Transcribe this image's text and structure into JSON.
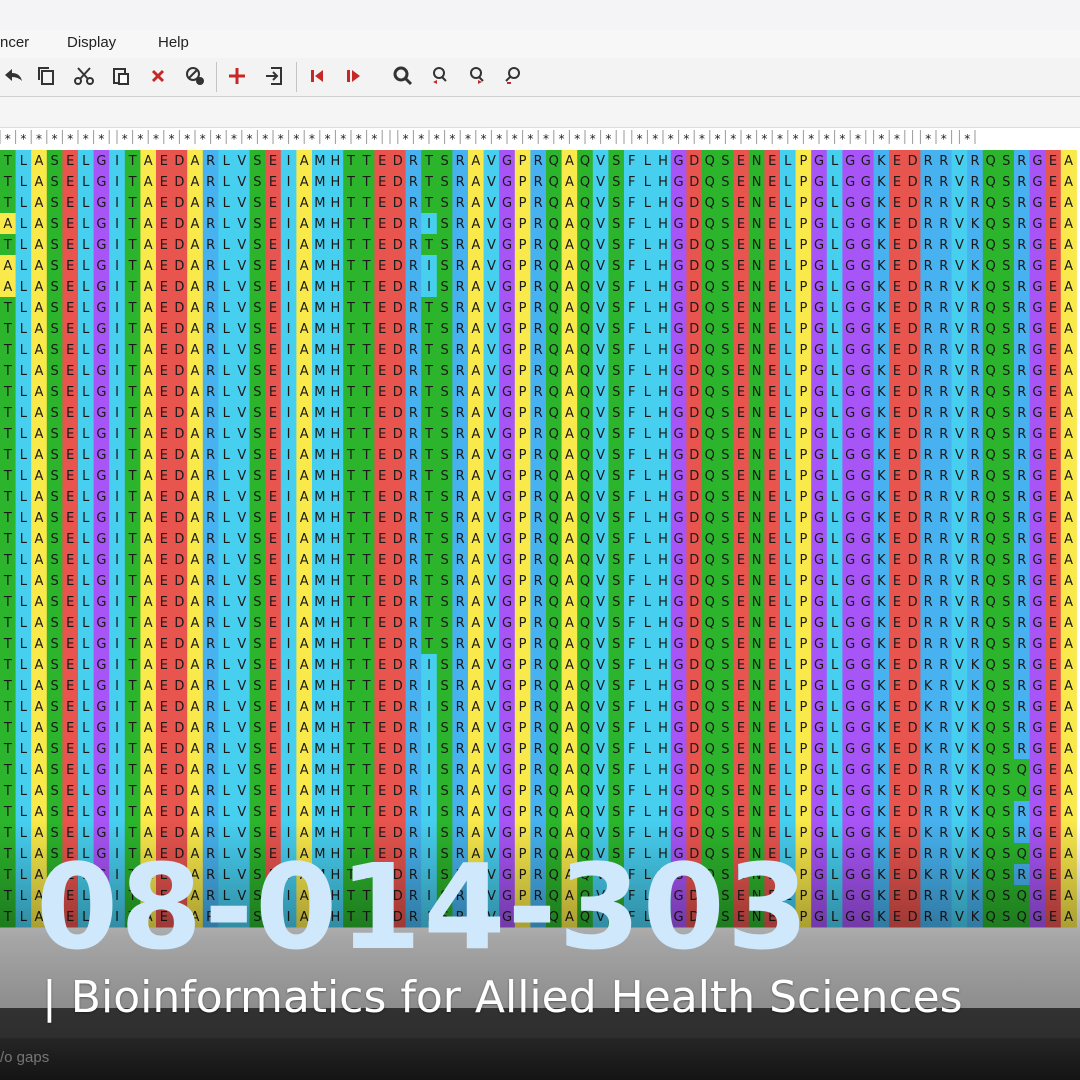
{
  "menu": {
    "items": [
      "ncer",
      "Display",
      "Help"
    ]
  },
  "toolbar": {
    "buttons": [
      {
        "name": "undo-icon",
        "color": "#333333"
      },
      {
        "name": "copy-icon",
        "color": "#333333"
      },
      {
        "name": "cut-icon",
        "color": "#333333"
      },
      {
        "name": "paste-icon",
        "color": "#333333"
      },
      {
        "name": "delete-icon",
        "color": "#c62828"
      },
      {
        "name": "search-sequence-icon",
        "color": "#333333"
      },
      {
        "name": "add-icon",
        "color": "#c62828"
      },
      {
        "name": "import-icon",
        "color": "#333333"
      },
      {
        "name": "previous-icon",
        "color": "#c62828"
      },
      {
        "name": "next-icon",
        "color": "#c62828"
      },
      {
        "name": "zoom-icon",
        "color": "#333333"
      },
      {
        "name": "find-previous-icon",
        "color": "#333333"
      },
      {
        "name": "find-next-icon",
        "color": "#333333"
      },
      {
        "name": "find-reset-icon",
        "color": "#333333"
      }
    ]
  },
  "alignment": {
    "conservation": "|*|*|*|*|*|*|*||*|*|*|*|*|*|*|*|*|*|*|*|*|*|*|*|*|||*|*|*|*|*|*|*|*|*|*|*|*|*|*|||*|*|*|*|*|*|*|*|*|*|*|*|*|*|*||*|*|||*|*||*|",
    "consensus": "TLASELGITAEDARLVSEIAMHTTEDRTSRAVGPRQAQVSFLHGDQSENELPGLGGKEDRRVRQSRGEA",
    "row_variants": [
      {
        "row": 3,
        "seq": "ALASELGITAEDARLVSEIAMHTTEDRISRAVGPRQAQVSFLHGDQSENELPGLGGKEDRRVKQSRGEA"
      },
      {
        "row": 5,
        "seq": "ALASELGITAEDARLVSEIAMHTTEDRISRAVGPRQAQVSFLHGDQSENELPGLGGKEDRRVKQSRGEA"
      },
      {
        "row": 6,
        "seq": "ALASELGITAEDARLVSEIAMHTTEDRISRAVGPRQAQVSFLHGDQSENELPGLGGKEDRRVKQSRGEA"
      },
      {
        "row": 24,
        "seq": "TLASELGITAEDARLVSEIAMHTTEDRISRAVGPRQAQVSFLHGDQSENELPGLGGKEDRRVKQSRGEA"
      },
      {
        "row": 25,
        "seq": "TLASELGITAEDARLVSEIAMHTTEDRISRAVGPRQAQVSFLHGDQSENELPGLGGKEDKRVKQSRGEA"
      },
      {
        "row": 26,
        "seq": "TLASELGITAEDARLVSEIAMHTTEDRISRAVGPRQAQVSFLHGDQSENELPGLGGKEDKRVKQSRGEA"
      },
      {
        "row": 27,
        "seq": "TLASELGITAEDARLVSEIAMHTTEDRISRAVGPRQAQVSFLHGDQSENELPGLGGKEDKRVKQSRGEA"
      },
      {
        "row": 28,
        "seq": "TLASELGITAEDARLVSEIAMHTTEDRISRAVGPRQAQVSFLHGDQSENELPGLGGKEDKRVKQSRGEA"
      },
      {
        "row": 29,
        "seq": "TLASELGITAEDARLVSEIAMHTTEDRISRAVGPRQAQVSFLHGDQSENELPGLGGKEDRRVKQSQGEA"
      },
      {
        "row": 30,
        "seq": "TLASELGITAEDARLVSEIAMHTTEDRISRAVGPRQAQVSFLHGDQSENELPGLGGKEDRRVKQSQGEA"
      },
      {
        "row": 31,
        "seq": "TLASELGITAEDARLVSEIAMHTTEDRISRAVGPRQAQVSFLHGDQSENELPGLGGKEDRRVKQSRGEA"
      },
      {
        "row": 32,
        "seq": "TLASELGITAEDARLVSEIAMHTTEDRISRAVGPRQAQVSFLHGDQSENELPGLGGKEDKRVKQSRGEA"
      },
      {
        "row": 33,
        "seq": "TLASELGITAEDARLVSEIAMHTTEDRISRAVGPRQAQVSFLHGDQSENELPGLGGKEDRRVKQSQGEA"
      },
      {
        "row": 34,
        "seq": "TLASELGITAEDARLVSEIAMHTTEDRISRAVGPRQAQVSFLHGDQSENELPGLGGKEDKRVKQSRGEA"
      },
      {
        "row": 35,
        "seq": "TLASELGITAEDARLVSEIAMHTTEDRISRAVGPRQAQVSFLHGDQSENELPGLGGKEDRRVKQSQGEA"
      },
      {
        "row": 36,
        "seq": "TLASELGITAEDARLVSEIAMHTTEDRISRAVGPRQAQVSFLHGDQSENELPGLGGKEDRRVKQSQGEA"
      }
    ],
    "row_count": 37,
    "colors": {
      "T": "#2cb52c",
      "S": "#2cb52c",
      "N": "#2cb52c",
      "Q": "#2cb52c",
      "G": "#a855f7",
      "P": "#f9e94b",
      "A": "#f9e94b",
      "L": "#47cff0",
      "V": "#47cff0",
      "I": "#47cff0",
      "M": "#47cff0",
      "F": "#47cff0",
      "E": "#e8544e",
      "D": "#e8544e",
      "R": "#47b2ef",
      "K": "#47b2ef",
      "H": "#47cff0",
      "C": "#f0a0a0"
    }
  },
  "title": {
    "course_code": "08-014-303",
    "course_name": "| Bioinformatics for Allied Health Sciences"
  },
  "status": {
    "text": "/o gaps"
  }
}
